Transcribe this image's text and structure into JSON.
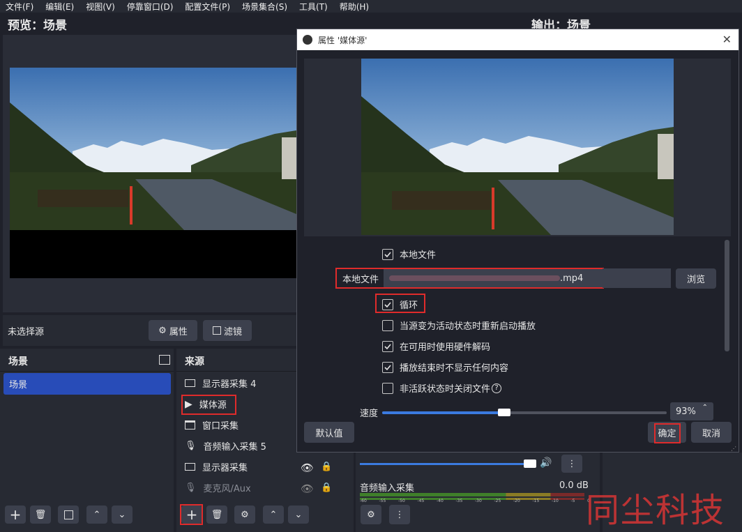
{
  "menu": [
    "文件(F)",
    "编辑(E)",
    "视图(V)",
    "停靠窗口(D)",
    "配置文件(P)",
    "场景集合(S)",
    "工具(T)",
    "帮助(H)"
  ],
  "preview_title": "预览：场景",
  "output_title": "输出：场景",
  "source_toolbar": {
    "no_source": "未选择源",
    "properties": "属性",
    "filters": "滤镜"
  },
  "scenes": {
    "title": "场景",
    "items": [
      "场景"
    ]
  },
  "sources": {
    "title": "来源",
    "items": [
      "显示器采集 4",
      "媒体源",
      "窗口采集",
      "音频输入采集 5",
      "显示器采集",
      "麦克风/Aux"
    ]
  },
  "mixer": {
    "channel": "音频输入采集",
    "db": "0.0 dB",
    "ticks": [
      "-60",
      "-55",
      "-50",
      "-45",
      "-40",
      "-35",
      "-30",
      "-25",
      "-20",
      "-15",
      "-10",
      "-5",
      "0"
    ],
    "volume": 1.0
  },
  "dialog": {
    "title": "属性 '媒体源'",
    "local_file_checkbox": "本地文件",
    "local_file_label": "本地文件",
    "file_suffix": ".mp4",
    "browse": "浏览",
    "options": [
      "循环",
      "当源变为活动状态时重新启动播放",
      "在可用时使用硬件解码",
      "播放结束时不显示任何内容",
      "非活跃状态时关闭文件"
    ],
    "checked": [
      true,
      false,
      true,
      true,
      false
    ],
    "speed_label": "速度",
    "speed_value": "93%",
    "speed_fraction": 0.43,
    "defaults": "默认值",
    "ok": "确定",
    "cancel": "取消"
  },
  "watermark": "同尘科技"
}
